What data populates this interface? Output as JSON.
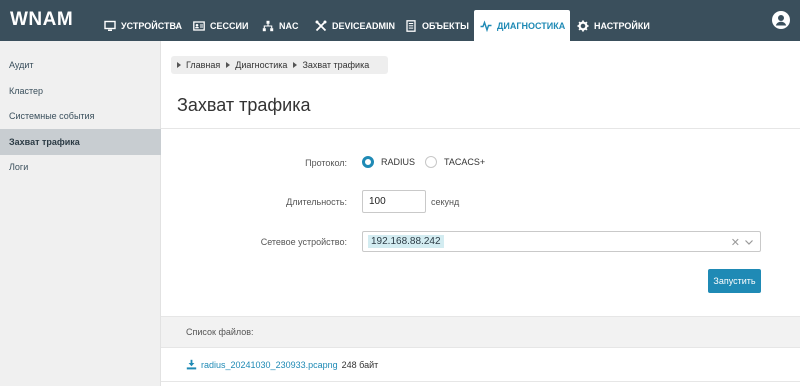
{
  "app": {
    "logo": "WNAM"
  },
  "nav": {
    "devices": "УСТРОЙСТВА",
    "sessions": "СЕССИИ",
    "nac": "NAC",
    "deviceadmin": "DEVICEADMIN",
    "objects": "ОБЪЕКТЫ",
    "diagnostics": "ДИАГНОСТИКА",
    "settings": "НАСТРОЙКИ"
  },
  "sidebar": {
    "items": [
      {
        "label": "Аудит"
      },
      {
        "label": "Кластер"
      },
      {
        "label": "Системные события"
      },
      {
        "label": "Захват трафика"
      },
      {
        "label": "Логи"
      }
    ]
  },
  "breadcrumb": [
    "Главная",
    "Диагностика",
    "Захват трафика"
  ],
  "page": {
    "title": "Захват трафика"
  },
  "form": {
    "protocol_label": "Протокол:",
    "protocol_options": [
      "RADIUS",
      "TACACS+"
    ],
    "protocol_selected": "RADIUS",
    "duration_label": "Длительность:",
    "duration_value": "100",
    "duration_unit": "секунд",
    "device_label": "Сетевое устройство:",
    "device_value": "192.168.88.242",
    "start_button": "Запустить"
  },
  "files": {
    "header": "Список файлов:",
    "items": [
      {
        "name": "radius_20241030_230933.pcapng",
        "size": "248 байт"
      }
    ]
  },
  "colors": {
    "topbar": "#3a4f5c",
    "accent": "#1f8ab5",
    "sidebar_active": "#c8cdd1"
  }
}
